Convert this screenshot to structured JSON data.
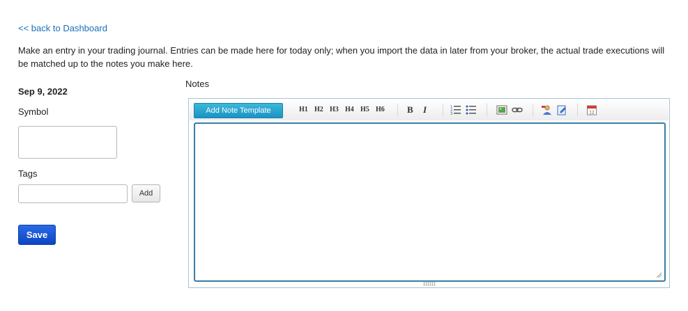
{
  "nav": {
    "back_link": "<< back to Dashboard"
  },
  "intro_text": "Make an entry in your trading journal. Entries can be made here for today only; when you import the data in later from your broker, the actual trade executions will be matched up to the notes you make here.",
  "form": {
    "date": "Sep 9, 2022",
    "symbol_label": "Symbol",
    "symbol_value": "",
    "tags_label": "Tags",
    "tags_value": "",
    "add_button": "Add",
    "save_button": "Save"
  },
  "notes": {
    "label": "Notes",
    "template_button": "Add Note Template",
    "headings": [
      "H1",
      "H2",
      "H3",
      "H4",
      "H5",
      "H6"
    ],
    "bold": "B",
    "italic": "I",
    "icons": [
      "ordered-list-icon",
      "unordered-list-icon",
      "image-icon",
      "link-icon",
      "user-icon",
      "edit-document-icon",
      "calendar-icon"
    ],
    "calendar_day": "12",
    "body": ""
  },
  "colors": {
    "link": "#1a6fb8",
    "save": "#0d45c4",
    "template": "#1a93c4",
    "editor_border": "#3a7ca5"
  }
}
